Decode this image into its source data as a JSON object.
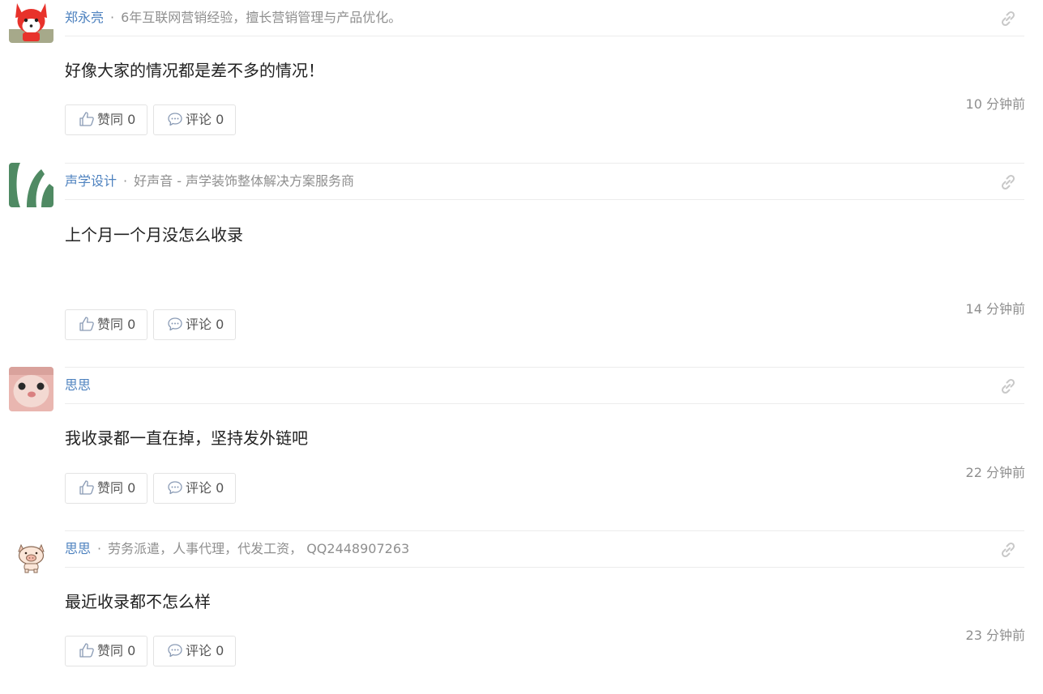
{
  "answers": [
    {
      "author": "郑永亮",
      "bio": "6年互联网营销经验，擅长营销管理与产品优化。",
      "content": "好像大家的情况都是差不多的情况！",
      "time": "10 分钟前",
      "like_label": "赞同 0",
      "comment_label": "评论 0",
      "avatar_icon": "fox-avatar-icon"
    },
    {
      "author": "声学设计",
      "bio": "好声音 - 声学装饰整体解决方案服务商",
      "content": "上个月一个月没怎么收录",
      "time": "14 分钟前",
      "like_label": "赞同 0",
      "comment_label": "评论 0",
      "avatar_icon": "green-logo-avatar-icon"
    },
    {
      "author": "思思",
      "bio": "",
      "content": "我收录都一直在掉，坚持发外链吧",
      "time": "22 分钟前",
      "like_label": "赞同 0",
      "comment_label": "评论 0",
      "avatar_icon": "puppy-avatar-icon"
    },
    {
      "author": "思思",
      "bio": "劳务派遣，人事代理，代发工资， QQ2448907263",
      "content": "最近收录都不怎么样",
      "time": "23 分钟前",
      "like_label": "赞同 0",
      "comment_label": "评论 0",
      "avatar_icon": "pig-avatar-icon"
    }
  ],
  "separator": "·",
  "colors": {
    "author_link": "#4e82bf",
    "muted_text": "#8f8f8f",
    "divider": "#ececec",
    "button_border": "#e3e3e3"
  },
  "icons": {
    "permalink": "link-icon",
    "like": "thumbs-up-icon",
    "comment": "speech-bubble-icon"
  }
}
